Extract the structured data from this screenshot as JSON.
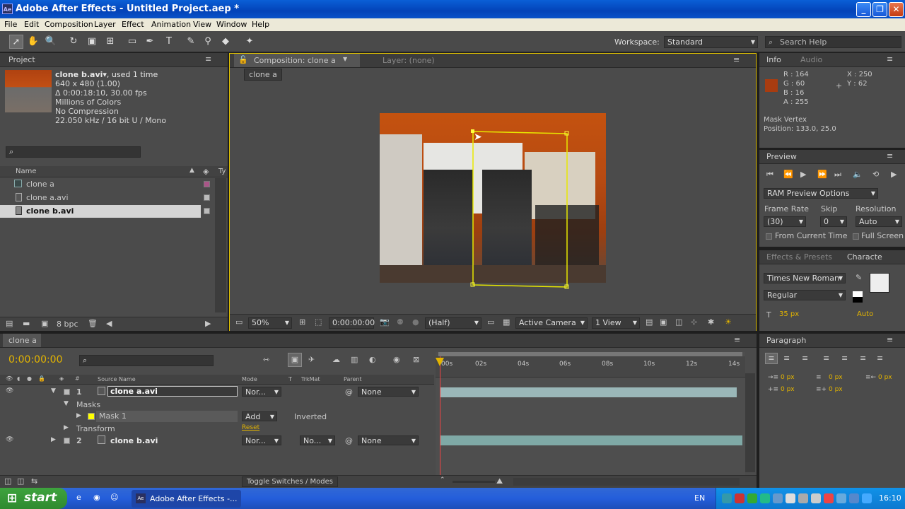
{
  "window": {
    "title": "Adobe After Effects - Untitled Project.aep *",
    "app_icon": "Ae"
  },
  "menu": [
    "File",
    "Edit",
    "Composition",
    "Layer",
    "Effect",
    "Animation",
    "View",
    "Window",
    "Help"
  ],
  "toolbar": {
    "workspace_label": "Workspace:",
    "workspace_value": "Standard",
    "search_placeholder": "Search Help"
  },
  "project": {
    "tab": "Project",
    "item_name": "clone b.avi",
    "used": ", used 1 time",
    "details": [
      "640 x 480 (1.00)",
      "Δ 0:00:18:10, 30.00 fps",
      "Millions of Colors",
      "No Compression",
      "22.050 kHz / 16 bit U / Mono"
    ],
    "col_name": "Name",
    "col_type": "Ty",
    "items": [
      "clone a",
      "clone a.avi",
      "clone b.avi"
    ],
    "bpc": "8 bpc"
  },
  "composition": {
    "tab": "Composition: clone a",
    "layer_tab": "Layer: (none)",
    "crumb": "clone a",
    "zoom": "50%",
    "timecode": "0:00:00:00",
    "resolution": "(Half)",
    "camera": "Active Camera",
    "view": "1 View"
  },
  "info": {
    "tab": "Info",
    "tab2": "Audio",
    "r": "R : 164",
    "g": "G : 60",
    "b": "B : 16",
    "a": "A : 255",
    "x": "X : 250",
    "y": "Y : 62",
    "swatch": "#a83c10",
    "line1": "Mask Vertex",
    "line2": "Position: 133.0, 25.0"
  },
  "preview": {
    "tab": "Preview",
    "ram": "RAM Preview Options",
    "frame_rate_label": "Frame Rate",
    "skip_label": "Skip",
    "resolution_label": "Resolution",
    "frame_rate": "(30)",
    "skip": "0",
    "resolution": "Auto",
    "from_current": "From Current Time",
    "full_screen": "Full Screen"
  },
  "character": {
    "tab1": "Effects & Presets",
    "tab2": "Characte",
    "font": "Times New Roman",
    "style": "Regular",
    "size": "35 px",
    "auto": "Auto"
  },
  "paragraph": {
    "tab": "Paragraph",
    "v1": "0 px",
    "v2": "0 px",
    "v3": "0 px",
    "v4": "0 px",
    "v5": "0 px"
  },
  "timeline": {
    "tab": "clone a",
    "timecode": "0:00:00:00",
    "cols": {
      "source": "Source Name",
      "mode": "Mode",
      "t": "T",
      "trkmat": "TrkMat",
      "parent": "Parent"
    },
    "ruler": [
      "00s",
      "02s",
      "04s",
      "06s",
      "08s",
      "10s",
      "12s",
      "14s"
    ],
    "layers": [
      {
        "num": "1",
        "name": "clone a.avi",
        "mode": "Nor...",
        "parent": "None"
      },
      {
        "num": "2",
        "name": "clone b.avi",
        "mode": "Nor...",
        "trkmat": "No...",
        "parent": "None"
      }
    ],
    "masks_label": "Masks",
    "mask_name": "Mask 1",
    "mask_mode": "Add",
    "inverted": "Inverted",
    "transform": "Transform",
    "reset": "Reset",
    "toggle": "Toggle Switches / Modes"
  },
  "taskbar": {
    "start": "start",
    "app_button": "Adobe After Effects -...",
    "lang": "EN",
    "clock": "16:10"
  }
}
